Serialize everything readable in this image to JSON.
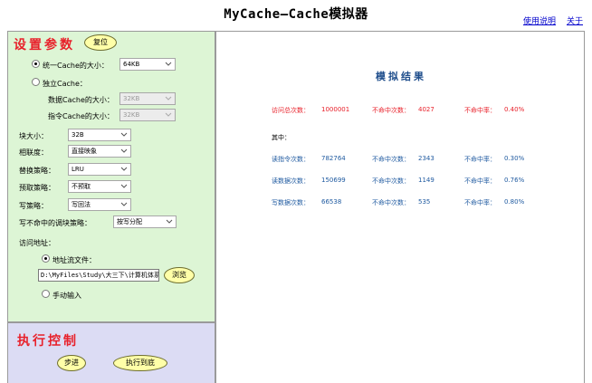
{
  "app": {
    "title": "MyCache—Cache模拟器"
  },
  "top_links": {
    "help": "使用说明",
    "about": "关于"
  },
  "settings": {
    "title": "设置参数",
    "reset_label": "复位",
    "unified_label": "统一Cache的大小：",
    "unified_value": "64KB",
    "split_label": "独立Cache：",
    "data_cache_label": "数据Cache的大小：",
    "data_cache_value": "32KB",
    "inst_cache_label": "指令Cache的大小：",
    "inst_cache_value": "32KB",
    "block_size_label": "块大小：",
    "block_size_value": "32B",
    "assoc_label": "相联度：",
    "assoc_value": "直接映象",
    "replace_label": "替换策略：",
    "replace_value": "LRU",
    "prefetch_label": "预取策略：",
    "prefetch_value": "不预取",
    "write_label": "写策略：",
    "write_value": "写回法",
    "write_miss_label": "写不命中的调块策略：",
    "write_miss_value": "按写分配",
    "address_label": "访问地址：",
    "addr_file_label": "地址流文件：",
    "addr_file_value": "D:\\MyFiles\\Study\\大三下\\计算机体系",
    "browse_label": "浏览",
    "manual_label": "手动输入"
  },
  "exec": {
    "title": "执行控制",
    "step_label": "步进",
    "run_label": "执行到底"
  },
  "results": {
    "title": "模拟结果",
    "total_label": "访问总次数：",
    "total_value": "1000001",
    "total_miss_label": "不命中次数：",
    "total_miss_value": "4027",
    "total_rate_label": "不命中率：",
    "total_rate_value": "0.40%",
    "among_label": "其中：",
    "rows": [
      {
        "label": "读指令次数：",
        "count": "782764",
        "miss_label": "不命中次数：",
        "miss": "2343",
        "rate_label": "不命中率：",
        "rate": "0.30%"
      },
      {
        "label": "读数据次数：",
        "count": "150699",
        "miss_label": "不命中次数：",
        "miss": "1149",
        "rate_label": "不命中率：",
        "rate": "0.76%"
      },
      {
        "label": "写数据次数：",
        "count": "66538",
        "miss_label": "不命中次数：",
        "miss": "535",
        "rate_label": "不命中率：",
        "rate": "0.80%"
      }
    ]
  },
  "colors": {
    "left_panel": "#ddf5d5",
    "exec_panel": "#dcdcf4",
    "section_title": "#e8202a",
    "button": "#ffffa8",
    "result_blue": "#1f5aa0",
    "result_red": "#e8202a"
  }
}
